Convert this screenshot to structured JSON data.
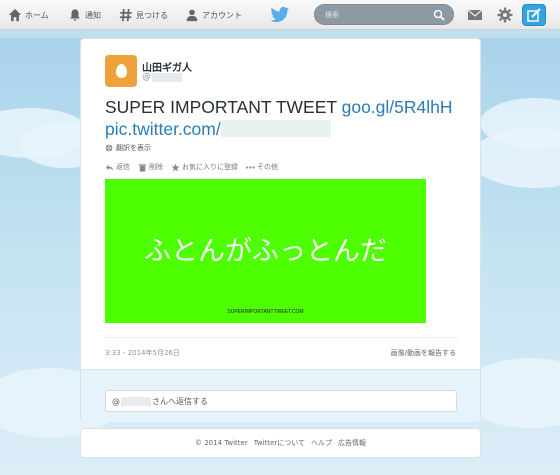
{
  "topbar": {
    "nav": [
      {
        "label": "ホーム",
        "icon": "home-icon"
      },
      {
        "label": "通知",
        "icon": "bell-icon"
      },
      {
        "label": "見つける",
        "icon": "hashtag-icon"
      },
      {
        "label": "アカウント",
        "icon": "person-icon"
      }
    ],
    "search_placeholder": "検索",
    "brand_color": "#55acee"
  },
  "tweet": {
    "name": "山田ギガ人",
    "handle_prefix": "@",
    "text": "SUPER IMPORTANT TWEET ",
    "link1": "goo.gl/5R4lhH",
    "link2": "pic.twitter.com/",
    "translate": "翻訳を表示",
    "actions": [
      {
        "label": "返信",
        "icon": "reply-icon"
      },
      {
        "label": "削除",
        "icon": "trash-icon"
      },
      {
        "label": "お気に入りに登録",
        "icon": "star-icon"
      },
      {
        "label": "その他",
        "icon": "more-icon"
      }
    ],
    "media_text": "ふとんがふっとんだ",
    "media_caption": "SUPERIMPORTANTTWEET.COM",
    "media_color": "#4dff00",
    "timestamp": "3:33 - 2014年5月26日",
    "report": "画像/動画を報告する",
    "reply_prefix": "@",
    "reply_suffix": "さんへ返信する"
  },
  "footer": {
    "copyright": "© 2014 Twitter",
    "links": [
      "Twitterについて",
      "ヘルプ",
      "広告情報"
    ]
  }
}
